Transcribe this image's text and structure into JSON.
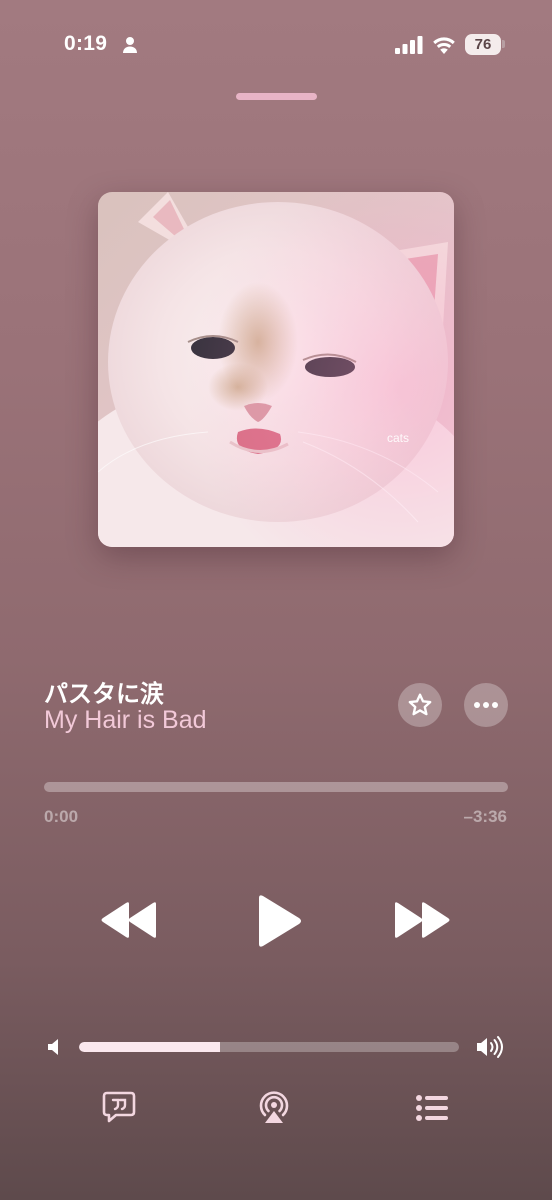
{
  "status_bar": {
    "time": "0:19",
    "battery": "76",
    "icons": [
      "person-icon",
      "cellular-signal-icon",
      "wifi-icon",
      "battery-icon"
    ]
  },
  "now_playing": {
    "artwork": {
      "watermark": "cats",
      "depicts": "white fluffy cat sticking out tongue"
    },
    "title": "パスタに涙",
    "artist": "My Hair is Bad",
    "elapsed": "0:00",
    "remaining": "–3:36",
    "progress": 0.0
  },
  "controls": {
    "favorite_icon": "star-icon",
    "more_icon": "ellipsis-icon",
    "rewind_icon": "rewind-icon",
    "play_icon": "play-icon",
    "forward_icon": "fast-forward-icon"
  },
  "volume": {
    "level": 0.37
  },
  "bottom_bar": [
    "lyrics-icon",
    "airplay-icon",
    "queue-icon"
  ],
  "colors": {
    "accent": "#f2c9d8",
    "grabber": "#e8b4c6",
    "background": "#9a7278"
  }
}
